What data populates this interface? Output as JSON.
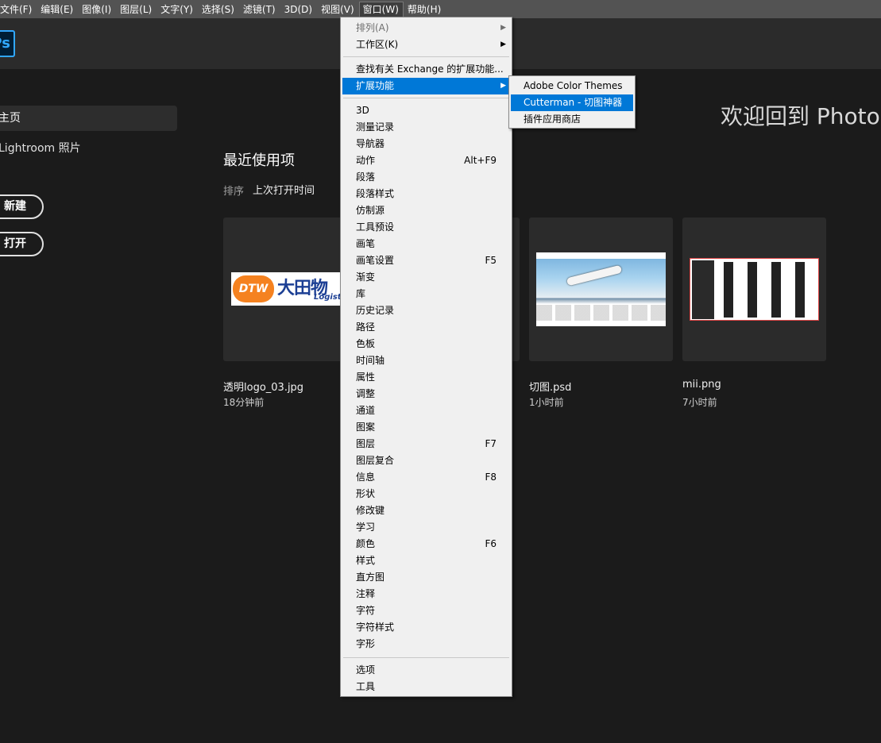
{
  "menubar": [
    "文件(F)",
    "编辑(E)",
    "图像(I)",
    "图层(L)",
    "文字(Y)",
    "选择(S)",
    "滤镜(T)",
    "3D(D)",
    "视图(V)",
    "窗口(W)",
    "帮助(H)"
  ],
  "app": {
    "logo": "Ps",
    "welcome": "欢迎回到 Photos"
  },
  "sidebar": {
    "home": "主页",
    "lightroom": "Lightroom 照片",
    "new_button": "新建",
    "open_button": "打开"
  },
  "recent": {
    "title": "最近使用项",
    "sort_label": "排序",
    "sort_value": "上次打开时间",
    "files": [
      {
        "name": "透明logo_03.jpg",
        "time": "18分钟前"
      },
      {
        "name": "切图.psd",
        "time": "1小时前"
      },
      {
        "name": "mii.png",
        "time": "7小时前"
      }
    ],
    "logo_thumb": {
      "badge": "DTW",
      "cn": "大田物",
      "en": "Logist"
    }
  },
  "window_menu": {
    "arrange": "排列(A)",
    "workspace": "工作区(K)",
    "find_exchange": "查找有关 Exchange 的扩展功能...",
    "extensions": "扩展功能",
    "items": [
      {
        "label": "3D",
        "shortcut": ""
      },
      {
        "label": "测量记录",
        "shortcut": ""
      },
      {
        "label": "导航器",
        "shortcut": ""
      },
      {
        "label": "动作",
        "shortcut": "Alt+F9"
      },
      {
        "label": "段落",
        "shortcut": ""
      },
      {
        "label": "段落样式",
        "shortcut": ""
      },
      {
        "label": "仿制源",
        "shortcut": ""
      },
      {
        "label": "工具预设",
        "shortcut": ""
      },
      {
        "label": "画笔",
        "shortcut": ""
      },
      {
        "label": "画笔设置",
        "shortcut": "F5"
      },
      {
        "label": "渐变",
        "shortcut": ""
      },
      {
        "label": "库",
        "shortcut": ""
      },
      {
        "label": "历史记录",
        "shortcut": ""
      },
      {
        "label": "路径",
        "shortcut": ""
      },
      {
        "label": "色板",
        "shortcut": ""
      },
      {
        "label": "时间轴",
        "shortcut": ""
      },
      {
        "label": "属性",
        "shortcut": ""
      },
      {
        "label": "调整",
        "shortcut": ""
      },
      {
        "label": "通道",
        "shortcut": ""
      },
      {
        "label": "图案",
        "shortcut": ""
      },
      {
        "label": "图层",
        "shortcut": "F7"
      },
      {
        "label": "图层复合",
        "shortcut": ""
      },
      {
        "label": "信息",
        "shortcut": "F8"
      },
      {
        "label": "形状",
        "shortcut": ""
      },
      {
        "label": "修改键",
        "shortcut": ""
      },
      {
        "label": "学习",
        "shortcut": ""
      },
      {
        "label": "颜色",
        "shortcut": "F6"
      },
      {
        "label": "样式",
        "shortcut": ""
      },
      {
        "label": "直方图",
        "shortcut": ""
      },
      {
        "label": "注释",
        "shortcut": ""
      },
      {
        "label": "字符",
        "shortcut": ""
      },
      {
        "label": "字符样式",
        "shortcut": ""
      },
      {
        "label": "字形",
        "shortcut": ""
      }
    ],
    "options": "选项",
    "tools": "工具"
  },
  "extensions_submenu": [
    "Adobe Color Themes",
    "Cutterman - 切图神器",
    "插件应用商店"
  ],
  "colors": {
    "highlight": "#0078d7",
    "menu_bg": "#f0f0f0",
    "accent": "#31a8ff"
  }
}
